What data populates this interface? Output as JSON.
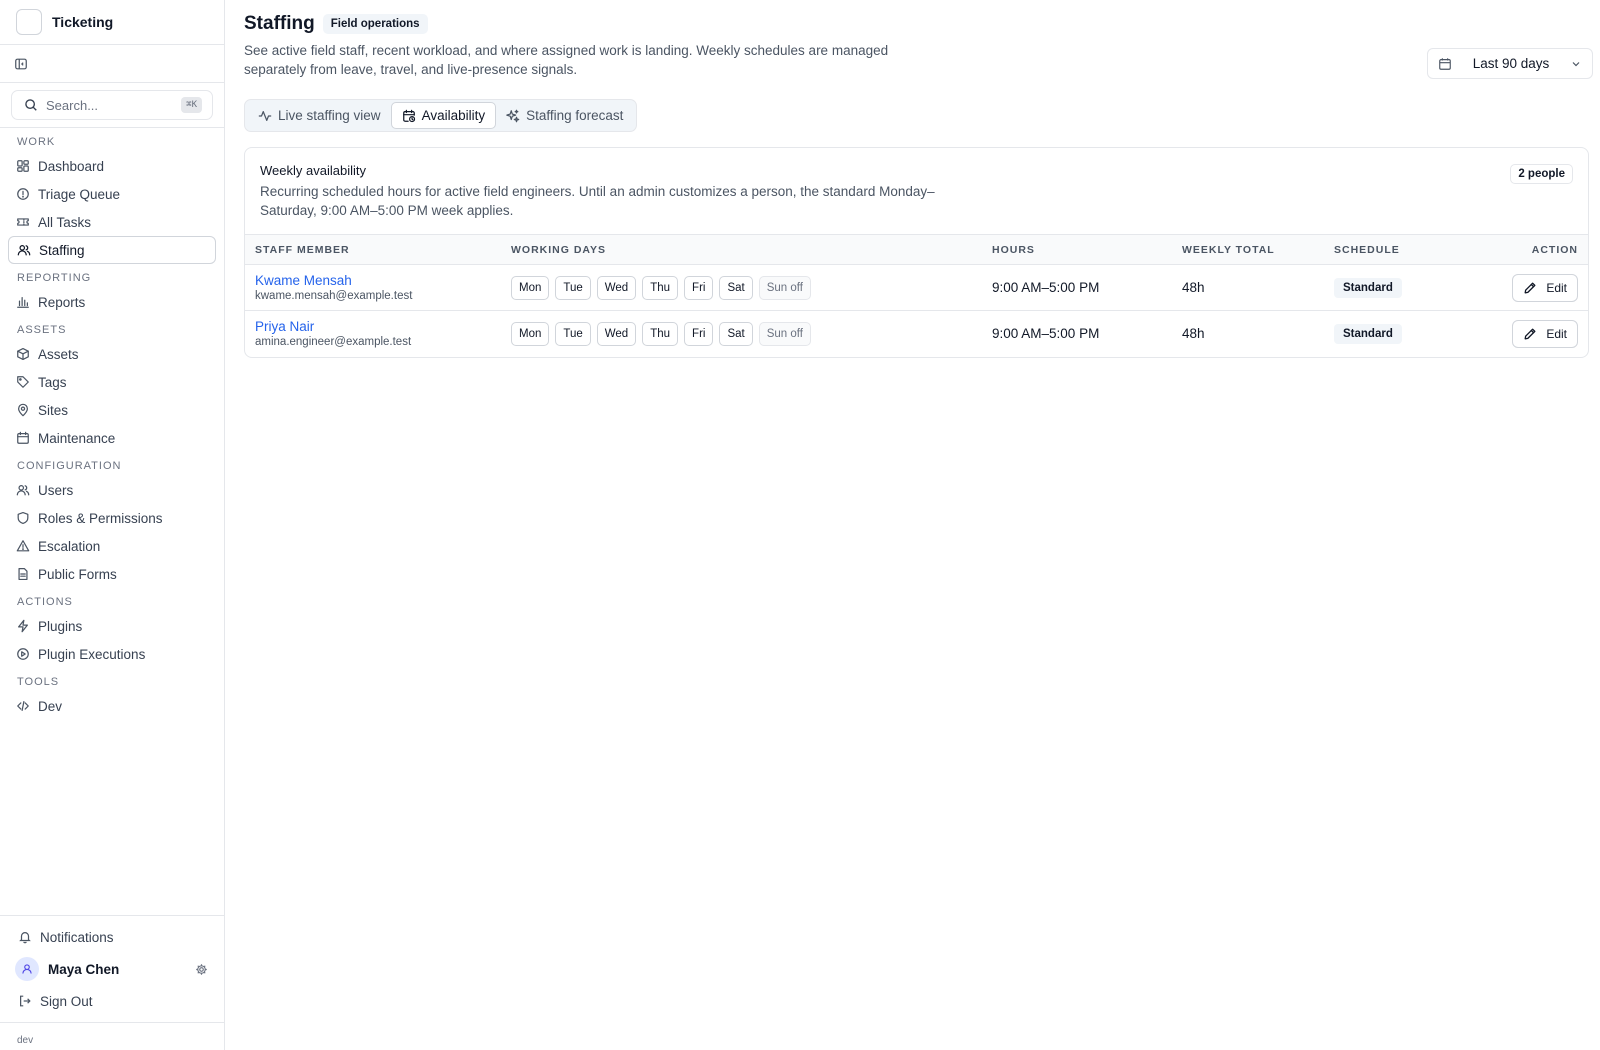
{
  "app": {
    "name": "Ticketing"
  },
  "search": {
    "placeholder": "Search...",
    "shortcut": "⌘K"
  },
  "sidebar": {
    "sections": [
      {
        "title": "Work",
        "items": [
          {
            "label": "Dashboard",
            "icon": "dashboard-icon"
          },
          {
            "label": "Triage Queue",
            "icon": "alert-circle-icon"
          },
          {
            "label": "All Tasks",
            "icon": "ticket-icon"
          },
          {
            "label": "Staffing",
            "icon": "users-icon",
            "active": true
          }
        ]
      },
      {
        "title": "Reporting",
        "items": [
          {
            "label": "Reports",
            "icon": "bar-chart-icon"
          }
        ]
      },
      {
        "title": "Assets",
        "items": [
          {
            "label": "Assets",
            "icon": "package-icon"
          },
          {
            "label": "Tags",
            "icon": "tag-icon"
          },
          {
            "label": "Sites",
            "icon": "map-pin-icon"
          },
          {
            "label": "Maintenance",
            "icon": "calendar-icon"
          }
        ]
      },
      {
        "title": "Configuration",
        "items": [
          {
            "label": "Users",
            "icon": "users-icon"
          },
          {
            "label": "Roles & Permissions",
            "icon": "shield-icon"
          },
          {
            "label": "Escalation",
            "icon": "warning-icon"
          },
          {
            "label": "Public Forms",
            "icon": "file-icon"
          }
        ]
      },
      {
        "title": "Actions",
        "items": [
          {
            "label": "Plugins",
            "icon": "zap-icon"
          },
          {
            "label": "Plugin Executions",
            "icon": "play-circle-icon"
          }
        ]
      },
      {
        "title": "Tools",
        "items": [
          {
            "label": "Dev",
            "icon": "code-icon"
          }
        ]
      }
    ],
    "footer": {
      "notifications": "Notifications",
      "user_name": "Maya Chen",
      "sign_out": "Sign Out",
      "env": "dev"
    }
  },
  "header": {
    "title": "Staffing",
    "badge": "Field operations",
    "subtitle": "See active field staff, recent workload, and where assigned work is landing. Weekly schedules are managed separately from leave, travel, and live-presence signals.",
    "date_range": "Last 90 days"
  },
  "tabs": [
    {
      "label": "Live staffing view",
      "icon": "activity-icon",
      "active": false
    },
    {
      "label": "Availability",
      "icon": "calendar-clock-icon",
      "active": true
    },
    {
      "label": "Staffing forecast",
      "icon": "sparkles-icon",
      "active": false
    }
  ],
  "card": {
    "title": "Weekly availability",
    "description": "Recurring scheduled hours for active field engineers. Until an admin customizes a person, the standard Monday–Saturday, 9:00 AM–5:00 PM week applies.",
    "count": "2 people",
    "columns": [
      "Staff member",
      "Working days",
      "Hours",
      "Weekly total",
      "Schedule",
      "Action"
    ],
    "rows": [
      {
        "name": "Kwame Mensah",
        "email": "kwame.mensah@example.test",
        "days": [
          "Mon",
          "Tue",
          "Wed",
          "Thu",
          "Fri",
          "Sat"
        ],
        "off": "Sun off",
        "hours": "9:00 AM–5:00 PM",
        "total": "48h",
        "schedule": "Standard",
        "action": "Edit"
      },
      {
        "name": "Priya Nair",
        "email": "amina.engineer@example.test",
        "days": [
          "Mon",
          "Tue",
          "Wed",
          "Thu",
          "Fri",
          "Sat"
        ],
        "off": "Sun off",
        "hours": "9:00 AM–5:00 PM",
        "total": "48h",
        "schedule": "Standard",
        "action": "Edit"
      }
    ]
  },
  "colors": {
    "link": "#2563eb",
    "border": "#e5e7eb",
    "muted": "#4b5563"
  }
}
